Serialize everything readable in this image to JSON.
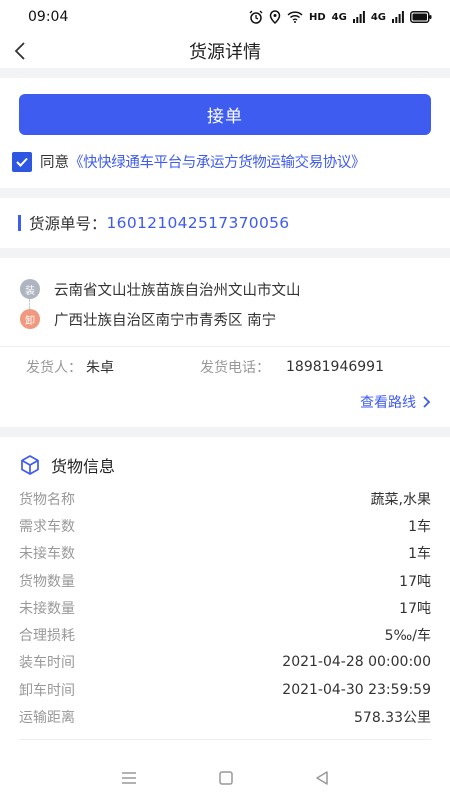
{
  "status_bar": {
    "time": "09:04",
    "network": "HD",
    "signal1": "4G",
    "signal2": "4G"
  },
  "nav": {
    "title": "货源详情"
  },
  "accept_button": "接单",
  "agreement": {
    "prefix": "同意",
    "link": "《快快绿通车平台与承运方货物运输交易协议》",
    "checked": true
  },
  "order": {
    "label": "货源单号：",
    "number": "160121042517370056"
  },
  "route": {
    "load_tag": "装",
    "load_address": "云南省文山壮族苗族自治州文山市文山",
    "unload_tag": "卸",
    "unload_address": "广西壮族自治区南宁市青秀区 南宁"
  },
  "sender": {
    "name_label": "发货人：",
    "name": "朱卓",
    "phone_label": "发货电话：",
    "phone": "18981946991"
  },
  "view_route": "查看路线",
  "goods": {
    "title": "货物信息",
    "rows": [
      {
        "k": "货物名称",
        "v": "蔬菜,水果"
      },
      {
        "k": "需求车数",
        "v": "1车"
      },
      {
        "k": "未接车数",
        "v": "1车"
      },
      {
        "k": "货物数量",
        "v": "17吨"
      },
      {
        "k": "未接数量",
        "v": "17吨"
      },
      {
        "k": "合理损耗",
        "v": "5‰/车"
      },
      {
        "k": "装车时间",
        "v": "2021-04-28 00:00:00"
      },
      {
        "k": "卸车时间",
        "v": "2021-04-30 23:59:59"
      },
      {
        "k": "运输距离",
        "v": "578.33公里"
      }
    ]
  },
  "colors": {
    "accent": "#3f5cf0",
    "load_tag": "#aeb4c0",
    "unload_tag": "#f0997e"
  }
}
